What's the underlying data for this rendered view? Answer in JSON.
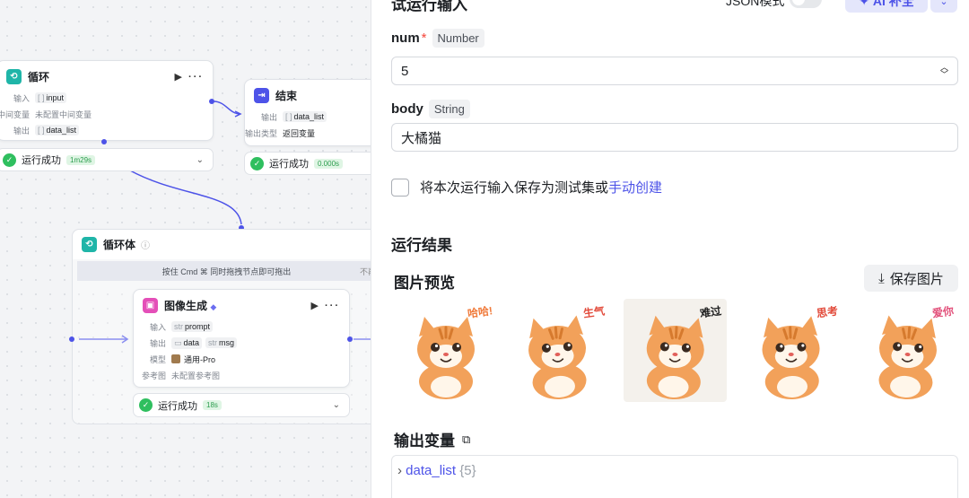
{
  "canvas": {
    "loop_node": {
      "title": "循环",
      "input_label": "输入",
      "input_var": "input",
      "mid_label": "中间变量",
      "mid_value": "未配置中间变量",
      "output_label": "输出",
      "output_var": "data_list",
      "status": "运行成功",
      "duration": "1m29s"
    },
    "end_node": {
      "title": "结束",
      "output_label": "输出",
      "output_var": "data_list",
      "output_type_label": "输出类型",
      "output_type_value": "返回变量",
      "status": "运行成功",
      "duration": "0.000s"
    },
    "loop_body": {
      "title": "循环体",
      "hint": "按住 Cmd ⌘ 同时拖拽节点即可拖出",
      "hint_extra": "不再"
    },
    "image_node": {
      "title": "图像生成",
      "input_label": "输入",
      "input_var": "prompt",
      "output_label": "输出",
      "output_var1": "data",
      "output_var2": "msg",
      "model_label": "模型",
      "model_value": "通用-Pro",
      "ref_label": "参考图",
      "ref_value": "未配置参考图",
      "status": "运行成功",
      "duration": "18s"
    }
  },
  "panel": {
    "header_title": "试运行输入",
    "json_mode": "JSON模式",
    "ai_button": "AI 补全",
    "num_label": "num",
    "num_required": "*",
    "num_type": "Number",
    "num_value": "5",
    "body_label": "body",
    "body_type": "String",
    "body_value": "大橘猫",
    "save_checkbox_text": "将本次运行输入保存为测试集或",
    "save_checkbox_link": "手动创建",
    "run_result_title": "运行结果",
    "preview_title": "图片预览",
    "save_image_button": "保存图片",
    "images": [
      {
        "caption": "哈哈!"
      },
      {
        "caption": "生气"
      },
      {
        "caption": "难过"
      },
      {
        "caption": "思考"
      },
      {
        "caption": "爱你"
      }
    ],
    "output_vars_title": "输出变量",
    "output_var_name": "data_list",
    "output_var_count": "{5}"
  },
  "colors": {
    "accent": "#4d53e8",
    "success": "#2fbf5f",
    "loop_icon": "#1fb5a8",
    "image_icon": "#e44fb8",
    "cat_orange": "#f2a15a"
  },
  "icons": [
    "loop-icon",
    "end-icon",
    "image-gen-icon",
    "check-icon",
    "download-icon",
    "copy-icon",
    "sparkle-icon",
    "info-icon"
  ]
}
